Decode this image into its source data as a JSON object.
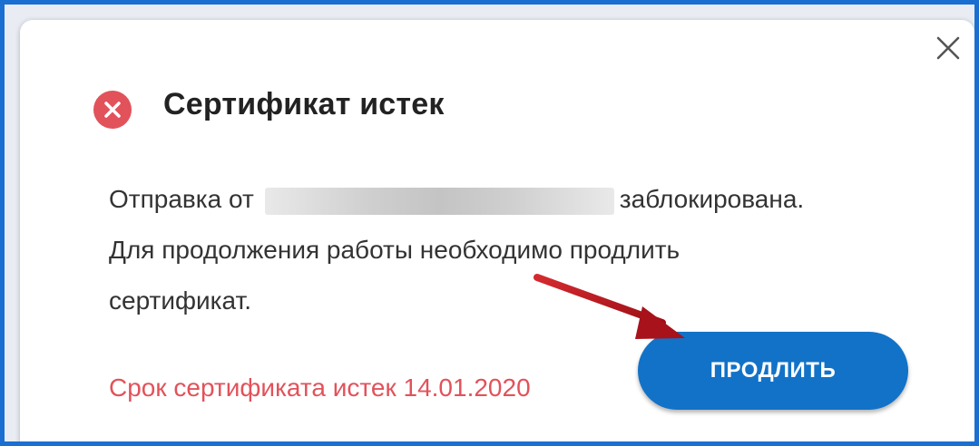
{
  "dialog": {
    "title": "Сертификат истек",
    "message": {
      "line1_prefix": "Отправка от",
      "line1_suffix": "заблокирована.",
      "line2": "Для продолжения работы необходимо продлить",
      "line3": "сертификат."
    },
    "expiry_text": "Срок сертификата истек 14.01.2020",
    "renew_button_label": "ПРОДЛИТЬ",
    "close_icon": "close-icon",
    "status_icon": "error-icon"
  },
  "colors": {
    "frame_border": "#1a6fd1",
    "error_red": "#e2525a",
    "button_blue": "#1272c8",
    "arrow_red": "#b3121b"
  }
}
